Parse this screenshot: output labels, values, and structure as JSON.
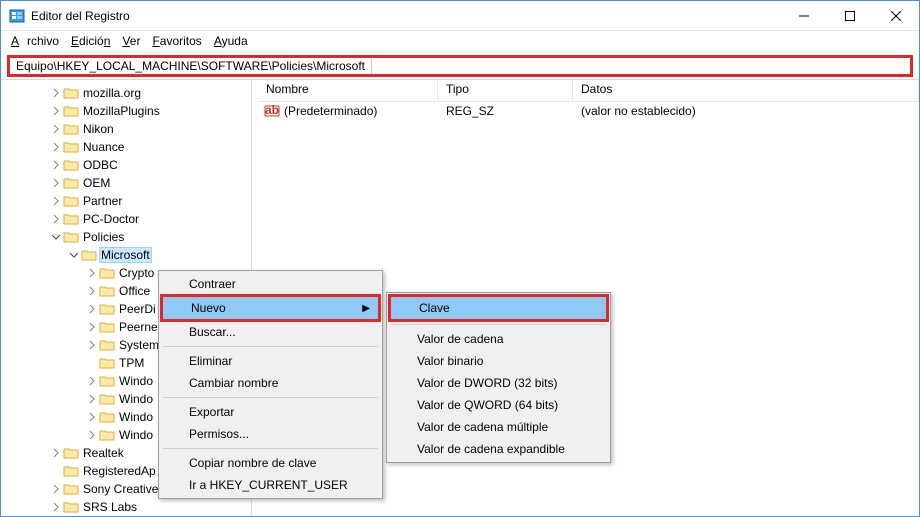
{
  "window": {
    "title": "Editor del Registro"
  },
  "menu": {
    "archivo": "Archivo",
    "edicion": "Edición",
    "ver": "Ver",
    "favoritos": "Favoritos",
    "ayuda": "Ayuda"
  },
  "address": {
    "label": "Equipo",
    "path": "HKEY_LOCAL_MACHINE\\SOFTWARE\\Policies\\Microsoft"
  },
  "tree": [
    {
      "label": "mozilla.org",
      "indent": 1,
      "tw": ">"
    },
    {
      "label": "MozillaPlugins",
      "indent": 1,
      "tw": ">"
    },
    {
      "label": "Nikon",
      "indent": 1,
      "tw": ">"
    },
    {
      "label": "Nuance",
      "indent": 1,
      "tw": ">"
    },
    {
      "label": "ODBC",
      "indent": 1,
      "tw": ">"
    },
    {
      "label": "OEM",
      "indent": 1,
      "tw": ">"
    },
    {
      "label": "Partner",
      "indent": 1,
      "tw": ">"
    },
    {
      "label": "PC-Doctor",
      "indent": 1,
      "tw": ">"
    },
    {
      "label": "Policies",
      "indent": 1,
      "tw": "v"
    },
    {
      "label": "Microsoft",
      "indent": 2,
      "tw": "v",
      "sel": true
    },
    {
      "label": "Cryptography",
      "indent": 3,
      "tw": ">",
      "cut": "Crypto"
    },
    {
      "label": "Office",
      "indent": 3,
      "tw": ">",
      "cut": "Office"
    },
    {
      "label": "PeerDist",
      "indent": 3,
      "tw": ">",
      "cut": "PeerDi"
    },
    {
      "label": "Peernet",
      "indent": 3,
      "tw": ">",
      "cut": "Peerne"
    },
    {
      "label": "SystemCertificates",
      "indent": 3,
      "tw": ">",
      "cut": "System"
    },
    {
      "label": "TPM",
      "indent": 3,
      "tw": "",
      "cut": "TPM"
    },
    {
      "label": "Windows",
      "indent": 3,
      "tw": ">",
      "cut": "Windo"
    },
    {
      "label": "Windows Defender",
      "indent": 3,
      "tw": ">",
      "cut": "Windo"
    },
    {
      "label": "Windows NT",
      "indent": 3,
      "tw": ">",
      "cut": "Windo"
    },
    {
      "label": "WindowsStore",
      "indent": 3,
      "tw": ">",
      "cut": "Windo"
    },
    {
      "label": "Realtek",
      "indent": 1,
      "tw": ">"
    },
    {
      "label": "RegisteredApplications",
      "indent": 1,
      "tw": "",
      "cut": "RegisteredAp"
    },
    {
      "label": "Sony Creative Software",
      "indent": 1,
      "tw": ">"
    },
    {
      "label": "SRS Labs",
      "indent": 1,
      "tw": ">",
      "cut": "SRS Labs"
    }
  ],
  "cols": {
    "name": "Nombre",
    "type": "Tipo",
    "data": "Datos"
  },
  "row": {
    "name": "(Predeterminado)",
    "type": "REG_SZ",
    "data": "(valor no establecido)"
  },
  "ctx": {
    "contraer": "Contraer",
    "nuevo": "Nuevo",
    "buscar": "Buscar...",
    "eliminar": "Eliminar",
    "cambiar": "Cambiar nombre",
    "exportar": "Exportar",
    "permisos": "Permisos...",
    "copiar": "Copiar nombre de clave",
    "ir": "Ir a HKEY_CURRENT_USER"
  },
  "sub": {
    "clave": "Clave",
    "v_cadena": "Valor de cadena",
    "v_binario": "Valor binario",
    "v_dword": "Valor de DWORD (32 bits)",
    "v_qword": "Valor de QWORD (64 bits)",
    "v_multi": "Valor de cadena múltiple",
    "v_exp": "Valor de cadena expandible"
  }
}
